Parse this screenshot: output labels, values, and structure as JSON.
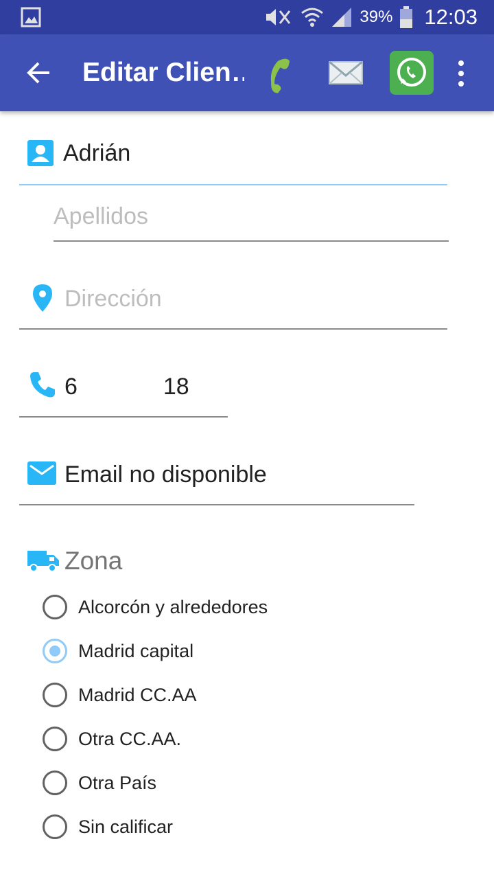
{
  "status_bar": {
    "battery": "39%",
    "time": "12:03"
  },
  "app_bar": {
    "title": "Editar Clien…",
    "actions": [
      "phone-icon",
      "mail-icon",
      "whatsapp-icon",
      "more-vert-icon"
    ]
  },
  "form": {
    "nombre": {
      "value": "Adrián"
    },
    "apellidos": {
      "placeholder": "Apellidos",
      "value": ""
    },
    "direccion": {
      "placeholder": "Dirección",
      "value": ""
    },
    "telefono": {
      "prefix": "6",
      "suffix": "18"
    },
    "email": {
      "value": "Email no disponible"
    },
    "zona": {
      "label": "Zona",
      "options": [
        {
          "label": "Alcorcón y alrededores",
          "checked": false
        },
        {
          "label": "Madrid capital",
          "checked": true
        },
        {
          "label": "Madrid CC.AA",
          "checked": false
        },
        {
          "label": "Otra CC.AA.",
          "checked": false
        },
        {
          "label": "Otra País",
          "checked": false
        },
        {
          "label": "Sin calificar",
          "checked": false
        }
      ]
    }
  },
  "colors": {
    "status_bar": "#303f9f",
    "app_bar": "#3f51b5",
    "icon_accent": "#29b6f6",
    "whatsapp": "#4caf50",
    "radio_checked": "#90caf9"
  }
}
